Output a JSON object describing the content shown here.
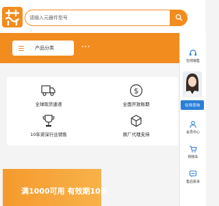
{
  "search": {
    "placeholder": "请输入元器件型号"
  },
  "nav": {
    "category_label": "产品分类",
    "more_label": "···"
  },
  "services": [
    {
      "label": "全球现货速递",
      "icon": "truck-icon"
    },
    {
      "label": "全面开放账期",
      "icon": "dollar-icon"
    },
    {
      "label": "10年资深行业销售",
      "icon": "trophy-icon"
    },
    {
      "label": "原厂代理支持",
      "icon": "box-icon"
    }
  ],
  "promo": {
    "text": "满1000可用 有效期10天"
  },
  "sidebar": {
    "sales_label": "在线销售",
    "consult_label": "在线咨询",
    "member_label": "会员中心",
    "cart_label": "购物车",
    "complaint_label": "售后投诉"
  },
  "colors": {
    "accent": "#f28c1f",
    "consult": "#2a7fd8"
  }
}
